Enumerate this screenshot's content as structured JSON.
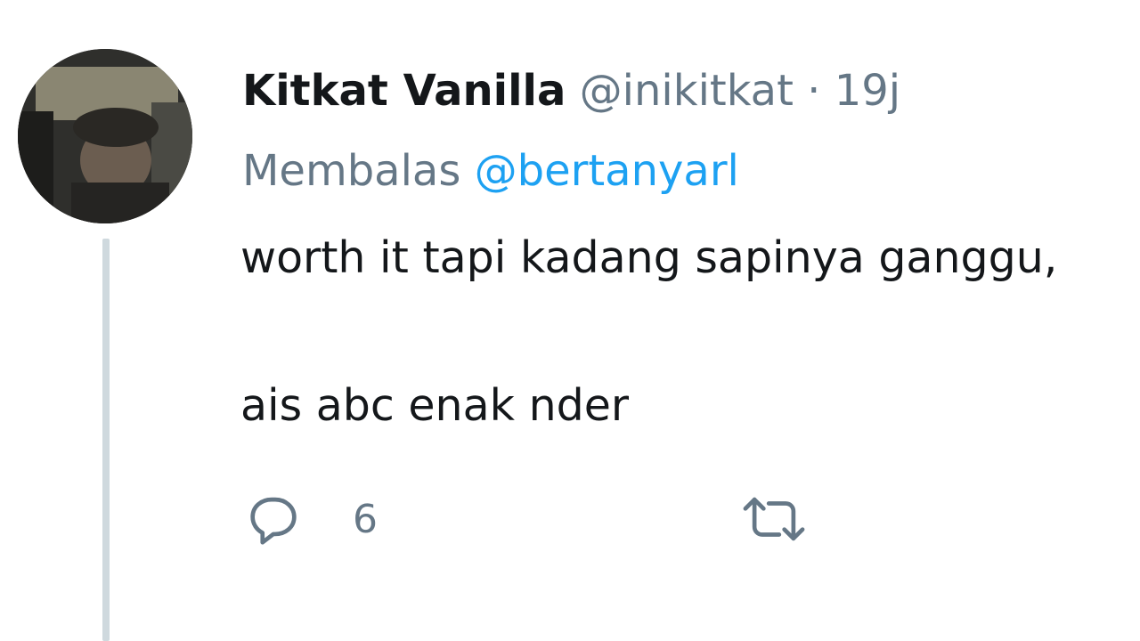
{
  "tweet": {
    "display_name": "Kitkat Vanilla",
    "handle": "@inikitkat",
    "separator": "·",
    "time": "19j",
    "replying_prefix": "Membalas",
    "replying_to": "@bertanyarl",
    "body_line1": "worth it tapi kadang sapinya ganggu,",
    "body_line2": "ais abc enak nder",
    "reply_count": "6",
    "retweet_count": ""
  },
  "colors": {
    "accent": "#1da1f2",
    "secondary_text": "#657786",
    "thread_line": "#cfd9de"
  },
  "icons": {
    "reply": "reply-icon",
    "retweet": "retweet-icon"
  }
}
